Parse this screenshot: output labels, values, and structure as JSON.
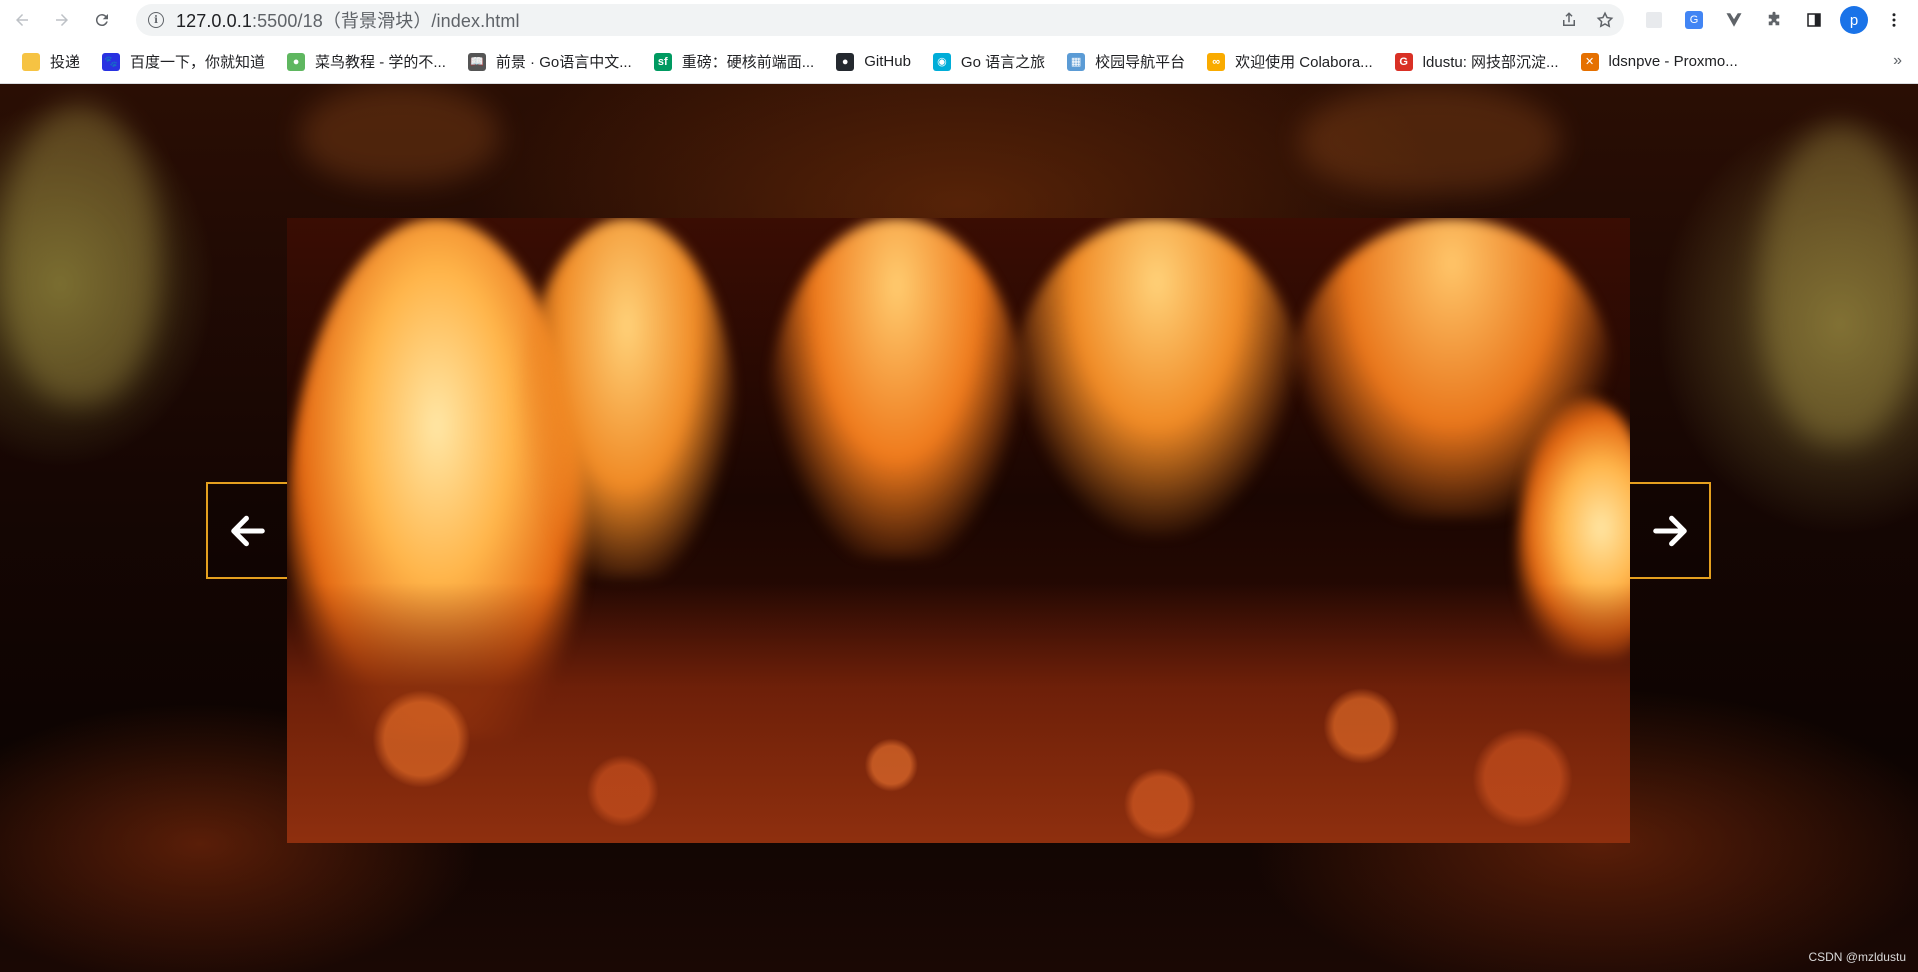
{
  "browser": {
    "url_host": "127.0.0.1",
    "url_rest": ":5500/18（背景滑块）/index.html",
    "profile_initial": "p",
    "more_bookmarks": "»"
  },
  "icons": {
    "back": "back-arrow-icon",
    "forward": "forward-arrow-icon",
    "reload": "reload-icon",
    "info": "info-icon",
    "share": "share-icon",
    "star": "star-icon",
    "extensions": "puzzle-icon",
    "side_panel": "side-panel-icon",
    "menu": "kebab-menu-icon",
    "slide_prev": "arrow-left-icon",
    "slide_next": "arrow-right-icon"
  },
  "bookmarks": [
    {
      "label": "投递",
      "icon": "folder-icon",
      "color": "#f6c343",
      "glyph": ""
    },
    {
      "label": "百度一下，你就知道",
      "icon": "baidu-icon",
      "color": "#2932e1",
      "glyph": "🐾"
    },
    {
      "label": "菜鸟教程 - 学的不...",
      "icon": "runoob-icon",
      "color": "#5fb760",
      "glyph": "●"
    },
    {
      "label": "前景 · Go语言中文...",
      "icon": "book-icon",
      "color": "#555555",
      "glyph": "📖"
    },
    {
      "label": "重磅：硬核前端面...",
      "icon": "segmentfault-icon",
      "color": "#009a61",
      "glyph": "sf"
    },
    {
      "label": "GitHub",
      "icon": "github-icon",
      "color": "#24292f",
      "glyph": "●"
    },
    {
      "label": "Go 语言之旅",
      "icon": "gopher-icon",
      "color": "#00add8",
      "glyph": "◉"
    },
    {
      "label": "校园导航平台",
      "icon": "campus-icon",
      "color": "#5b9bd5",
      "glyph": "▦"
    },
    {
      "label": "欢迎使用 Colabora...",
      "icon": "colab-icon",
      "color": "#f9ab00",
      "glyph": "∞"
    },
    {
      "label": "ldustu: 网技部沉淀...",
      "icon": "ldustu-icon",
      "color": "#d93025",
      "glyph": "G"
    },
    {
      "label": "ldsnpve - Proxmo...",
      "icon": "proxmox-icon",
      "color": "#e57000",
      "glyph": "✕"
    }
  ],
  "page": {
    "watermark": "CSDN @mzldustu"
  },
  "colors": {
    "arrow_border": "#e5a01f",
    "arrow_glyph": "#ffffff"
  }
}
